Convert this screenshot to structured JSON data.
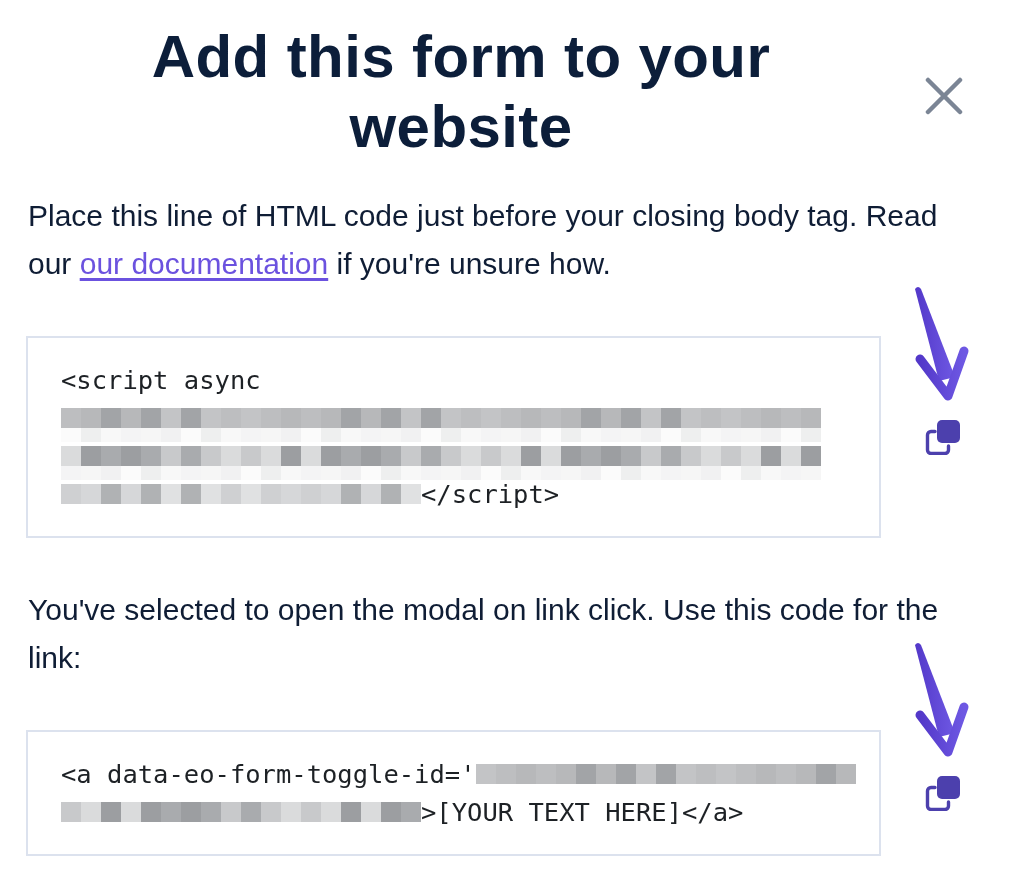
{
  "dialog": {
    "title": "Add this form to your website"
  },
  "sections": [
    {
      "instruction": {
        "before": "Place this line of HTML code just before your closing body tag. Read our ",
        "link": "our documentation",
        "after": " if you're unsure how."
      },
      "code_lines": [
        [
          {
            "kind": "text",
            "text": "<script async"
          }
        ],
        [
          {
            "kind": "redacted"
          }
        ],
        [
          {
            "kind": "redacted"
          }
        ],
        [
          {
            "kind": "redacted"
          },
          {
            "kind": "text",
            "text": "</script>"
          }
        ]
      ],
      "pointer_arrow": true
    },
    {
      "instruction": {
        "before": "You've selected to open the modal on link click. Use this code for the link:"
      },
      "code_lines": [
        [
          {
            "kind": "text",
            "text": "<a data-eo-form-toggle-id='"
          },
          {
            "kind": "redacted"
          }
        ],
        [
          {
            "kind": "redacted"
          },
          {
            "kind": "text",
            "text": ">[YOUR TEXT HERE]</a>"
          }
        ]
      ],
      "pointer_arrow": true
    }
  ]
}
